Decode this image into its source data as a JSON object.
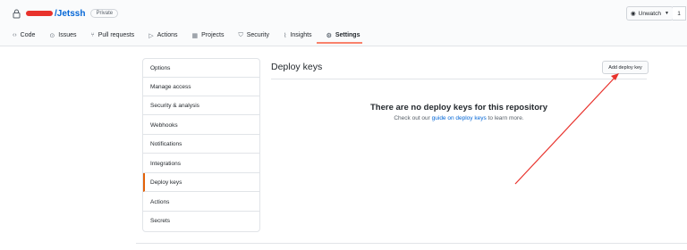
{
  "repo": {
    "name": "Jetssh",
    "visibility": "Private",
    "owner_separator": "/"
  },
  "watch": {
    "label": "Unwatch",
    "count": "1"
  },
  "tabs": [
    {
      "label": "Code",
      "icon": "code-icon"
    },
    {
      "label": "Issues",
      "icon": "issues-icon"
    },
    {
      "label": "Pull requests",
      "icon": "pull-request-icon"
    },
    {
      "label": "Actions",
      "icon": "actions-icon"
    },
    {
      "label": "Projects",
      "icon": "projects-icon"
    },
    {
      "label": "Security",
      "icon": "shield-icon"
    },
    {
      "label": "Insights",
      "icon": "graph-icon"
    },
    {
      "label": "Settings",
      "icon": "gear-icon"
    }
  ],
  "settings_menu": [
    "Options",
    "Manage access",
    "Security & analysis",
    "Webhooks",
    "Notifications",
    "Integrations",
    "Deploy keys",
    "Actions",
    "Secrets"
  ],
  "selected_menu": "Deploy keys",
  "main": {
    "title": "Deploy keys",
    "add_button": "Add deploy key",
    "empty_title": "There are no deploy keys for this repository",
    "empty_prefix": "Check out our ",
    "empty_link": "guide on deploy keys",
    "empty_suffix": " to learn more."
  },
  "colors": {
    "accent_underline": "#f9826c",
    "link": "#0366d6",
    "arrow": "#e8322c"
  }
}
